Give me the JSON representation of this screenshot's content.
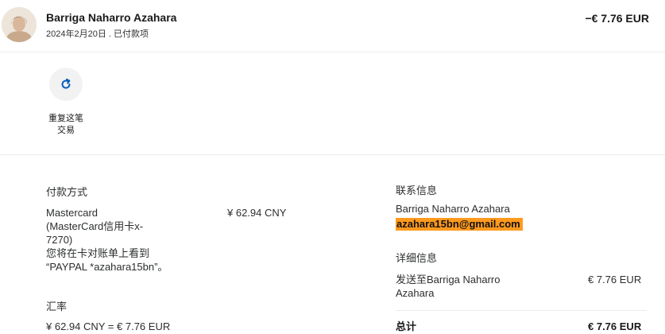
{
  "header": {
    "name": "Barriga Naharro Azahara",
    "date_status": "2024年2月20日 . 已付款项",
    "amount": "−€ 7.76 EUR"
  },
  "actions": {
    "repeat_label_line1": "重复这笔",
    "repeat_label_line2": "交易",
    "repeat_icon": "refresh-icon"
  },
  "payment": {
    "title": "付款方式",
    "method_lines": [
      "Mastercard",
      "(MasterCard信用卡x-",
      "7270)",
      "您将在卡对账单上看到",
      "“PAYPAL *azahara15bn”。"
    ],
    "amount": "¥ 62.94 CNY"
  },
  "exchange": {
    "title": "汇率",
    "rate": "¥ 62.94 CNY = € 7.76 EUR"
  },
  "contact": {
    "title": "联系信息",
    "name": "Barriga Naharro Azahara",
    "email": "azahara15bn@gmail.com"
  },
  "details": {
    "title": "详细信息",
    "sent_to_line1": "发送至Barriga Naharro",
    "sent_to_line2": "Azahara",
    "sent_amount": "€ 7.76 EUR",
    "total_label": "总计",
    "total_amount": "€ 7.76 EUR"
  },
  "colors": {
    "email_highlight": "#ff9a1f",
    "icon_blue": "#0a5fbd"
  }
}
